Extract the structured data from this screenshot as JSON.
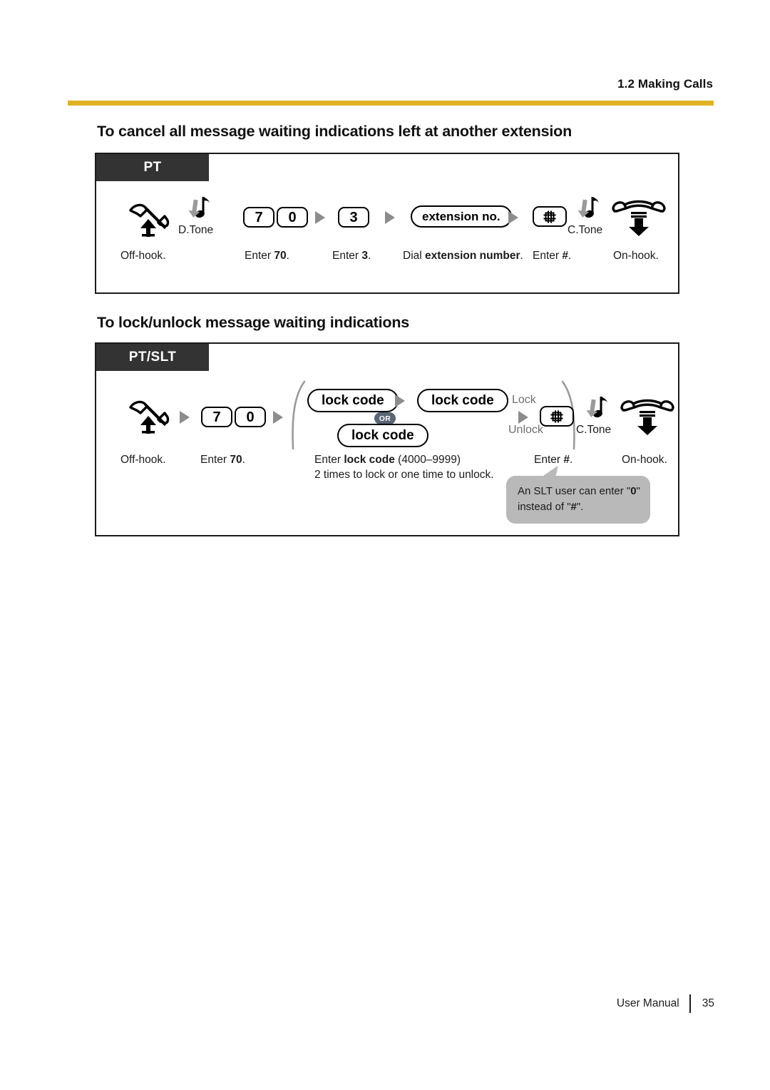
{
  "running_head": "1.2 Making Calls",
  "accent_color": "#e0b122",
  "tag_color": "#333333",
  "sections": [
    {
      "heading": "To cancel all message waiting indications left at another extension",
      "mode_tag": "PT",
      "steps": [
        {
          "icon": "off-hook-handset-icon",
          "label": "Off-hook."
        },
        {
          "tone": "D.Tone"
        },
        {
          "keys": [
            "7",
            "0"
          ],
          "label_prefix": "Enter ",
          "label_bold": "70",
          "label_suffix": "."
        },
        {
          "keys": [
            "3"
          ],
          "label_prefix": "Enter ",
          "label_bold": "3",
          "label_suffix": "."
        },
        {
          "pill": "extension no.",
          "label_prefix": "Dial ",
          "label_bold": "extension number",
          "label_suffix": "."
        },
        {
          "keys": [
            "#"
          ],
          "label_prefix": "Enter ",
          "label_bold": "#",
          "label_suffix": "."
        },
        {
          "tone": "C.Tone"
        },
        {
          "icon": "on-hook-handset-icon",
          "label": "On-hook."
        }
      ]
    },
    {
      "heading": "To lock/unlock message waiting indications",
      "mode_tag": "PT/SLT",
      "steps": [
        {
          "icon": "off-hook-handset-icon",
          "label": "Off-hook."
        },
        {
          "keys": [
            "7",
            "0"
          ],
          "label_prefix": "Enter ",
          "label_bold": "70",
          "label_suffix": "."
        },
        {
          "group": {
            "option_a": [
              "lock code",
              "lock code"
            ],
            "or_badge": "OR",
            "option_b": [
              "lock code"
            ],
            "side_labels": [
              "Lock",
              "Unlock"
            ]
          },
          "label_line1_prefix": "Enter ",
          "label_line1_bold": "lock code",
          "label_line1_suffix": " (4000–9999)",
          "label_line2": "2 times to lock or one time to unlock."
        },
        {
          "keys": [
            "#"
          ],
          "label_prefix": "Enter ",
          "label_bold": "#",
          "label_suffix": "."
        },
        {
          "tone": "C.Tone"
        },
        {
          "icon": "on-hook-handset-icon",
          "label": "On-hook."
        }
      ],
      "callout": {
        "line1_prefix": "An SLT user can enter \"",
        "line1_bold": "0",
        "line1_suffix": "\"",
        "line2_prefix": "instead of \"",
        "line2_bold": "#",
        "line2_suffix": "\"."
      }
    }
  ],
  "footer": {
    "manual": "User Manual",
    "page": "35"
  }
}
